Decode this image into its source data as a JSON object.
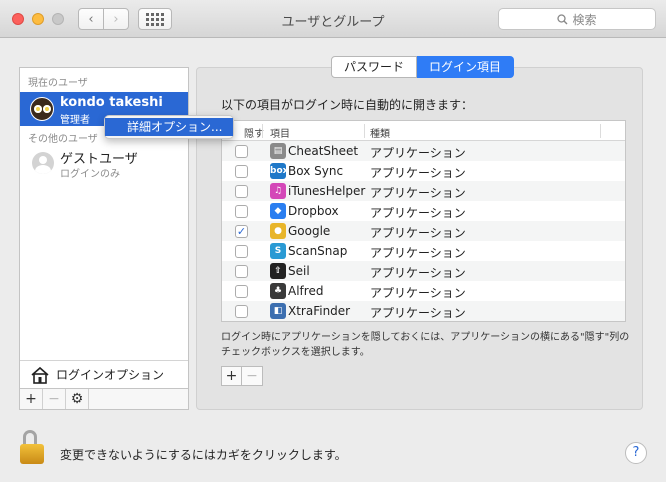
{
  "window": {
    "title": "ユーザとグループ",
    "search_placeholder": "検索",
    "nav_back": "‹",
    "nav_forward": "›"
  },
  "sidebar": {
    "current_users_label": "現在のユーザ",
    "current_user": {
      "name": "kondo takeshi",
      "role": "管理者"
    },
    "other_users_label": "その他のユーザ",
    "other_users": [
      {
        "name": "ゲストユーザ",
        "role": "ログインのみ"
      }
    ],
    "login_options_label": "ログインオプション",
    "add_label": "+",
    "remove_label": "−",
    "gear_label": "⚙"
  },
  "context_menu": {
    "item": "詳細オプション..."
  },
  "tabs": [
    {
      "label": "パスワード",
      "selected": false
    },
    {
      "label": "ログイン項目",
      "selected": true
    }
  ],
  "login_items": {
    "heading": "以下の項目がログイン時に自動的に開きます：",
    "columns": {
      "hide": "隠す",
      "item": "項目",
      "kind": "種類"
    },
    "rows": [
      {
        "name": "CheatSheet",
        "kind": "アプリケーション",
        "hidden": false,
        "icon": "cheatsheet-icon",
        "icon_glyph": "▤",
        "icon_color": "#8a8a8a"
      },
      {
        "name": "Box Sync",
        "kind": "アプリケーション",
        "hidden": false,
        "icon": "box-sync-icon",
        "icon_glyph": "box",
        "icon_color": "#1e78c8"
      },
      {
        "name": "iTunesHelper",
        "kind": "アプリケーション",
        "hidden": false,
        "icon": "itunes-icon",
        "icon_glyph": "♫",
        "icon_color": "#d448b8"
      },
      {
        "name": "Dropbox",
        "kind": "アプリケーション",
        "hidden": false,
        "icon": "dropbox-icon",
        "icon_glyph": "◆",
        "icon_color": "#2a7ef0"
      },
      {
        "name": "Google",
        "kind": "アプリケーション",
        "hidden": true,
        "icon": "google-chrome-icon",
        "icon_glyph": "●",
        "icon_color": "#e8b52a"
      },
      {
        "name": "ScanSnap",
        "kind": "アプリケーション",
        "hidden": false,
        "icon": "scansnap-icon",
        "icon_glyph": "S",
        "icon_color": "#2a9ad4"
      },
      {
        "name": "Seil",
        "kind": "アプリケーション",
        "hidden": false,
        "icon": "seil-icon",
        "icon_glyph": "⇧",
        "icon_color": "#222222"
      },
      {
        "name": "Alfred",
        "kind": "アプリケーション",
        "hidden": false,
        "icon": "alfred-icon",
        "icon_glyph": "♣",
        "icon_color": "#3a3a3a"
      },
      {
        "name": "XtraFinder",
        "kind": "アプリケーション",
        "hidden": false,
        "icon": "xtrafinder-icon",
        "icon_glyph": "◧",
        "icon_color": "#3c6fb0"
      }
    ],
    "hint": "ログイン時にアプリケーションを隠しておくには、アプリケーションの横にある\"隠す\"列のチェックボックスを選択します。",
    "add_label": "+",
    "remove_label": "−"
  },
  "footer": {
    "lock_text": "変更できないようにするにはカギをクリックします。",
    "help_label": "?"
  },
  "colors": {
    "accent": "#2a68d4",
    "segment_selected": "#2f7cf6"
  }
}
